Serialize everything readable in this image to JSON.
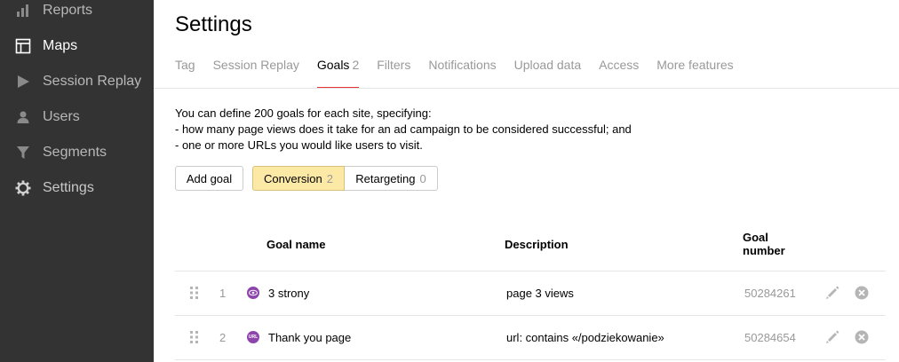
{
  "sidebar": {
    "items": [
      {
        "label": "Reports",
        "icon": "bar-chart-icon"
      },
      {
        "label": "Maps",
        "icon": "layout-icon",
        "active": true
      },
      {
        "label": "Session Replay",
        "icon": "play-icon"
      },
      {
        "label": "Users",
        "icon": "user-icon"
      },
      {
        "label": "Segments",
        "icon": "filter-icon"
      },
      {
        "label": "Settings",
        "icon": "gear-icon"
      }
    ]
  },
  "page": {
    "title": "Settings",
    "tabs": [
      {
        "label": "Tag"
      },
      {
        "label": "Session Replay"
      },
      {
        "label": "Goals",
        "count": "2",
        "active": true
      },
      {
        "label": "Filters"
      },
      {
        "label": "Notifications"
      },
      {
        "label": "Upload data"
      },
      {
        "label": "Access"
      },
      {
        "label": "More features"
      }
    ]
  },
  "intro": {
    "line1": "You can define 200 goals for each site, specifying:",
    "line2": "-  how many page views does it take for an ad campaign to be considered successful; and",
    "line3": "-  one or more URLs you would like users to visit."
  },
  "toolbar": {
    "add_goal": "Add goal",
    "conversion_label": "Conversion",
    "conversion_count": "2",
    "retargeting_label": "Retargeting",
    "retargeting_count": "0"
  },
  "table": {
    "headers": {
      "goal_name": "Goal name",
      "description": "Description",
      "goal_number_1": "Goal",
      "goal_number_2": "number"
    },
    "rows": [
      {
        "index": "1",
        "name": "3 strony",
        "description": "page 3 views",
        "number": "50284261",
        "icon": "eye-icon"
      },
      {
        "index": "2",
        "name": "Thank you page",
        "description": "url: contains «/podziekowanie»",
        "number": "50284654",
        "icon": "url-icon",
        "icon_text": "URL"
      }
    ]
  },
  "colors": {
    "sidebar_bg": "#333333",
    "active_tab_underline": "#e3342f",
    "conversion_bg": "#fde9a6",
    "goal_icon": "#8e44ad"
  }
}
